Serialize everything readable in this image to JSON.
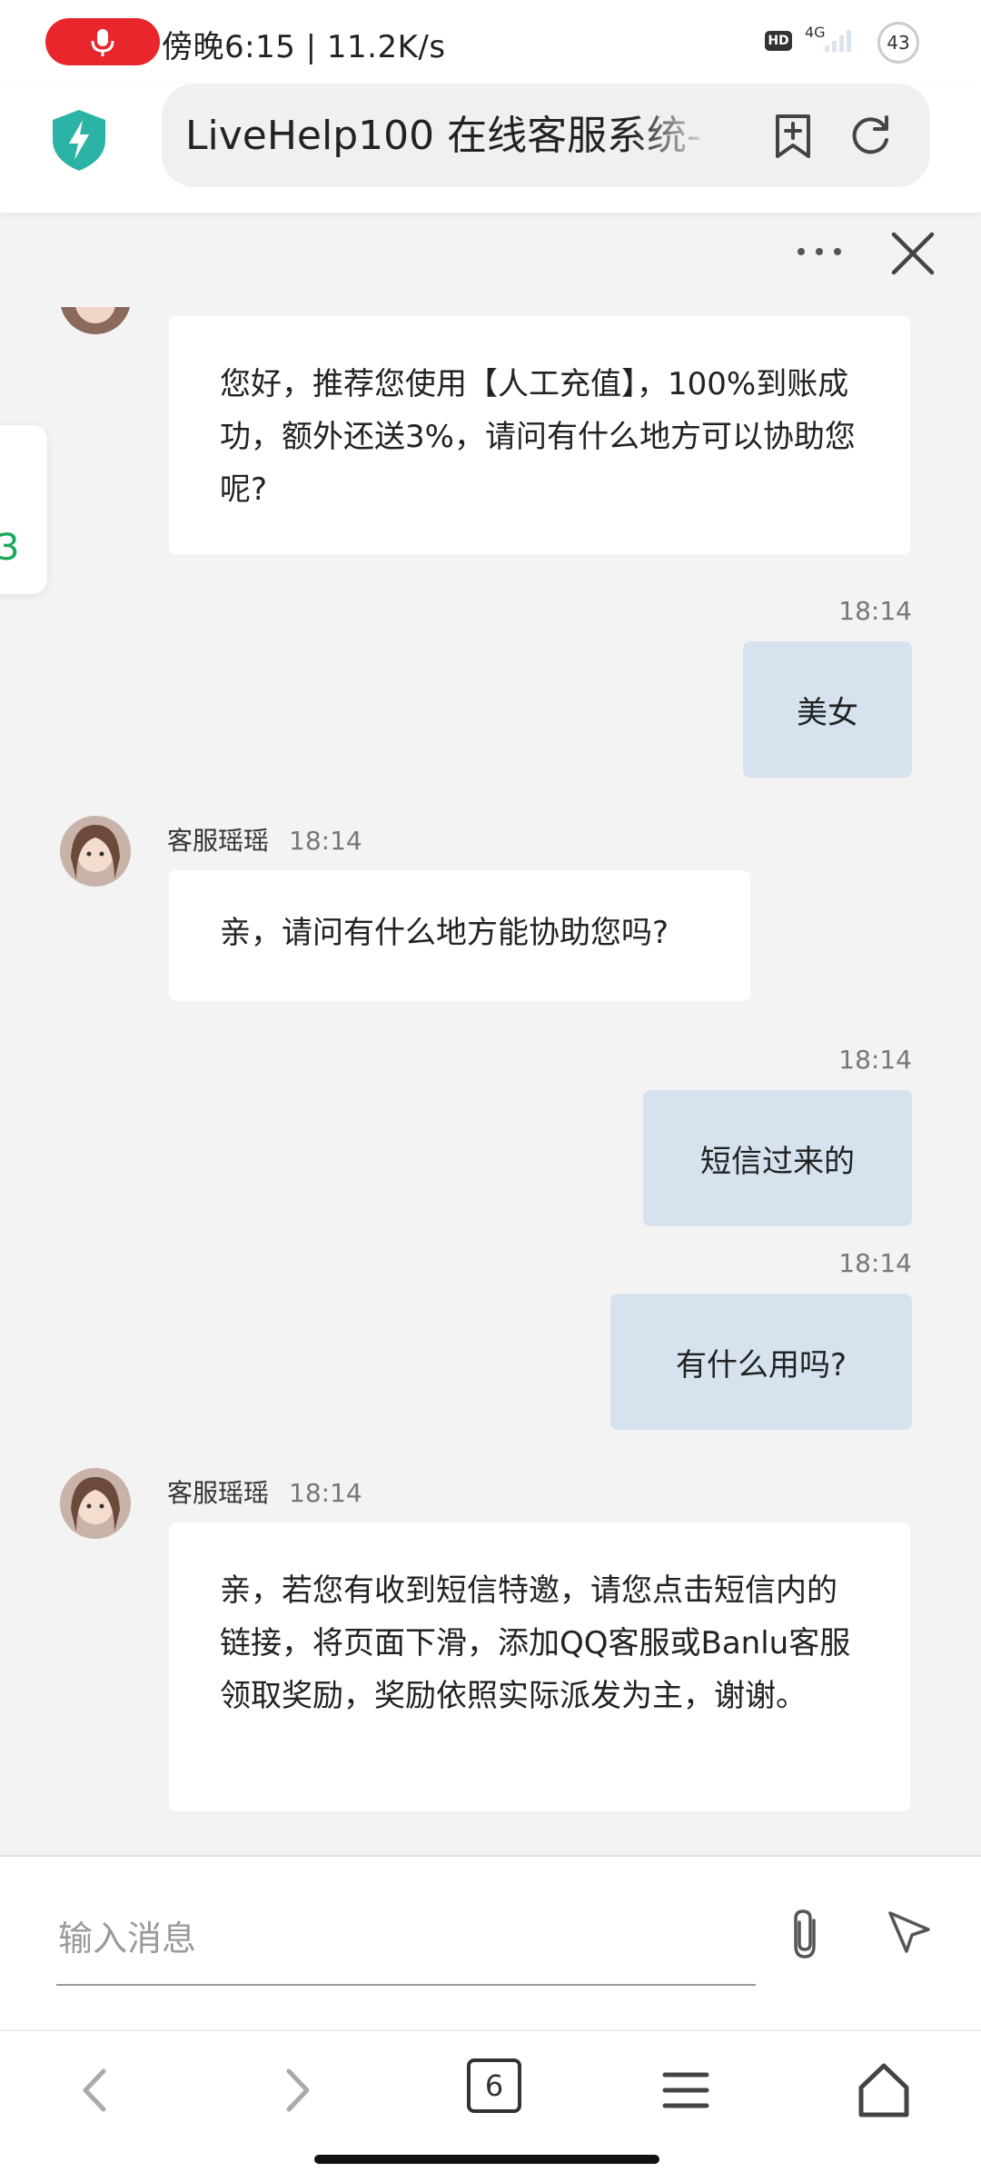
{
  "status_bar": {
    "text": "傍晚6:15 | 11.2K/s",
    "hd": "HD",
    "network": "4G",
    "battery": "43"
  },
  "browser": {
    "url_title": "LiveHelp100 在线客服系统-"
  },
  "side_tab": {
    "text": "3"
  },
  "messages": [
    {
      "text": "您好，推荐您使用【人工充值】，100%到账成功，额外还送3%，请问有什么地方可以协助您呢?"
    },
    {
      "time": "18:14",
      "text": "美女"
    },
    {
      "name": "客服瑶瑶",
      "time": "18:14",
      "text": "亲，请问有什么地方能协助您吗?"
    },
    {
      "time": "18:14",
      "text": "短信过来的"
    },
    {
      "time": "18:14",
      "text": "有什么用吗?"
    },
    {
      "name": "客服瑶瑶",
      "time": "18:14",
      "text": "亲，若您有收到短信特邀，请您点击短信内的链接，将页面下滑，添加QQ客服或Banlu客服领取奖励，奖励依照实际派发为主，谢谢。"
    }
  ],
  "input": {
    "placeholder": "输入消息"
  },
  "bottom_nav": {
    "tab_count": "6"
  },
  "colors": {
    "record_red": "#e8262b",
    "shield_teal": "#2bb3a5",
    "user_bubble": "#d6e3ee",
    "side_tab_green": "#19a85a"
  },
  "icons": [
    "microphone-icon",
    "shield-bolt-icon",
    "bookmark-add-icon",
    "refresh-icon",
    "more-icon",
    "close-icon",
    "paperclip-icon",
    "send-icon",
    "back-icon",
    "forward-icon",
    "menu-icon",
    "home-icon"
  ]
}
